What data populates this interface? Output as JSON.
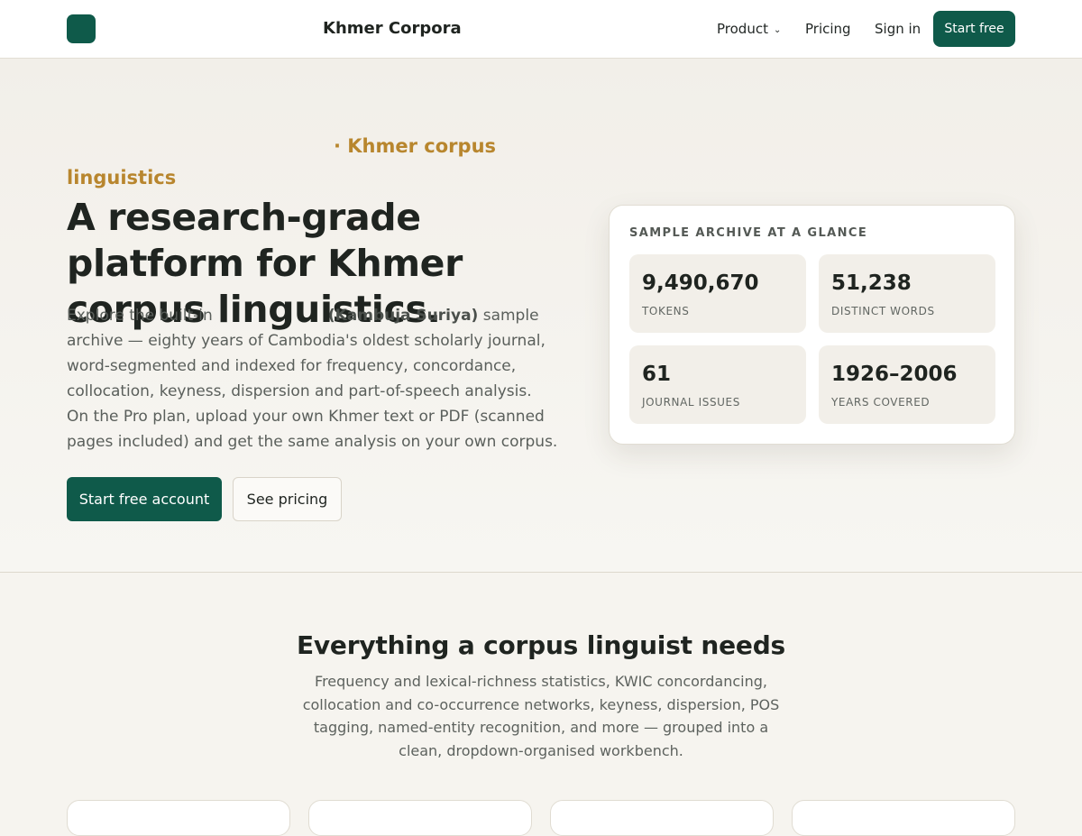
{
  "header": {
    "brand": "Khmer Corpora",
    "nav": {
      "product": "Product",
      "pricing": "Pricing",
      "sign_in": "Sign in",
      "start_free": "Start free"
    }
  },
  "hero": {
    "eyebrow": "· Khmer corpus linguistics",
    "title": "A research-grade platform for Khmer corpus linguistics.",
    "body_before": "Explore the built-in",
    "body_strong": "(Kambuja Suriya)",
    "body_after": "sample archive — eighty years of Cambodia's oldest scholarly journal, word-segmented and indexed for frequency, concordance, collocation, keyness, dispersion and part-of-speech analysis. On the Pro plan, upload your own Khmer text or PDF (scanned pages included) and get the same analysis on your own corpus.",
    "primary_button": "Start free account",
    "secondary_button": "See pricing"
  },
  "stats": {
    "heading": "SAMPLE ARCHIVE AT A GLANCE",
    "items": [
      {
        "value": "9,490,670",
        "label": "TOKENS"
      },
      {
        "value": "51,238",
        "label": "DISTINCT WORDS"
      },
      {
        "value": "61",
        "label": "JOURNAL ISSUES"
      },
      {
        "value": "1926–2006",
        "label": "YEARS COVERED"
      }
    ]
  },
  "features": {
    "title": "Everything a corpus linguist needs",
    "subtitle": "Frequency and lexical-richness statistics, KWIC concordancing, collocation and co-occurrence networks, keyness, dispersion, POS tagging, named-entity recognition, and more — grouped into a clean, dropdown-organised workbench."
  },
  "icons": {
    "product_dropdown": "chevron-down-icon"
  },
  "colors": {
    "brand": "#0f5a4a",
    "accent": "#b8862e",
    "background": "#f6f4ef"
  }
}
